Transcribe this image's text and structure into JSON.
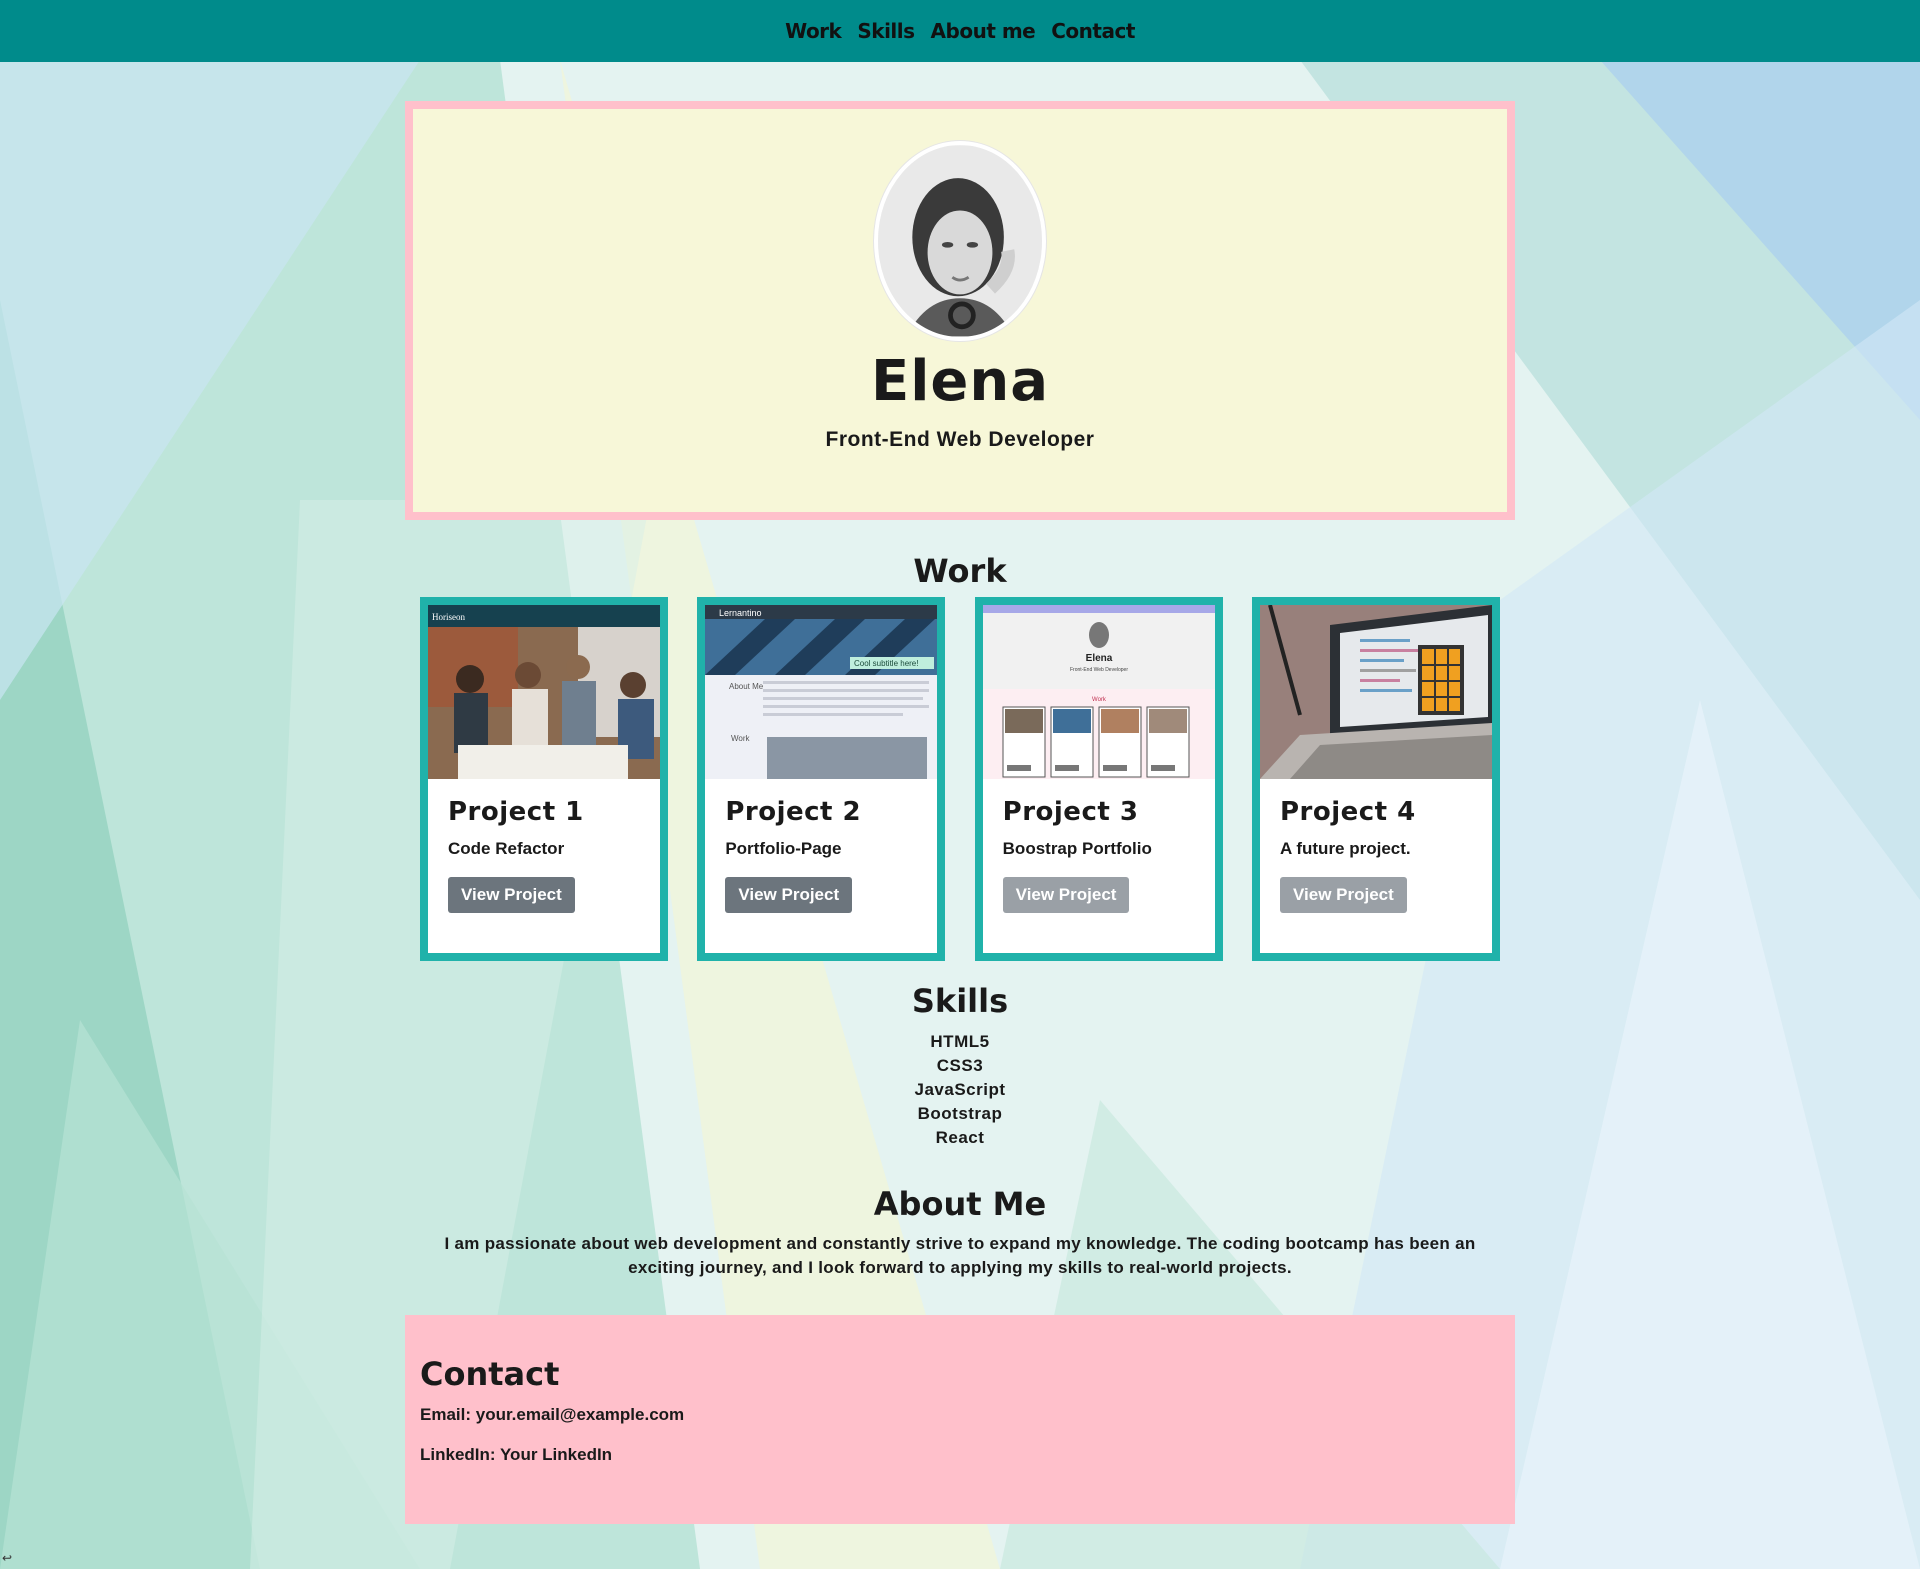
{
  "nav": {
    "items": [
      "Work",
      "Skills",
      "About me",
      "Contact"
    ]
  },
  "hero": {
    "name": "Elena",
    "subtitle": "Front-End Web Developer"
  },
  "work": {
    "title": "Work",
    "projects": [
      {
        "title": "Project 1",
        "description": "Code Refactor",
        "button": "View Project"
      },
      {
        "title": "Project 2",
        "description": "Portfolio-Page",
        "button": "View Project"
      },
      {
        "title": "Project 3",
        "description": "Boostrap Portfolio",
        "button": "View Project"
      },
      {
        "title": "Project 4",
        "description": "A future project.",
        "button": "View Project"
      }
    ],
    "thumbs": {
      "p1_brand": "Horiseon",
      "p2_brand": "Lernantino",
      "p2_banner": "Cool subtitle here!",
      "p2_about": "About Me",
      "p2_work": "Work",
      "p3_name": "Elena",
      "p3_sub": "Front-End Web Developer",
      "p3_work": "Work"
    }
  },
  "skills": {
    "title": "Skills",
    "items": [
      "HTML5",
      "CSS3",
      "JavaScript",
      "Bootstrap",
      "React"
    ]
  },
  "about": {
    "title": "About Me",
    "text": "I am passionate about web development and constantly strive to expand my knowledge. The coding bootcamp has been an exciting journey, and I look forward to applying my skills to real-world projects."
  },
  "contact": {
    "title": "Contact",
    "email_label": "Email:",
    "email": "your.email@example.com",
    "linkedin_label": "LinkedIn:",
    "linkedin": "Your LinkedIn"
  },
  "colors": {
    "navbar": "#008b8b",
    "hero_bg": "#f7f7d8",
    "hero_border": "#ffc0cb",
    "card_border": "#20b2aa",
    "button": "#6c757d",
    "contact_bg": "#ffc0cb"
  },
  "icons": {
    "corner": "return-arrow-icon"
  }
}
